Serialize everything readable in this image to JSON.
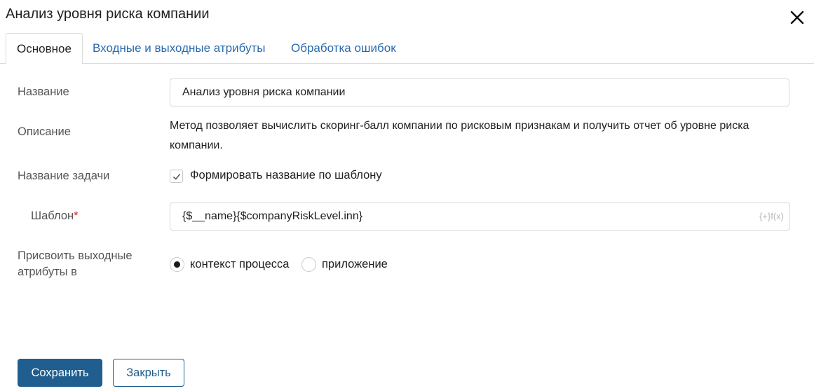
{
  "dialog": {
    "title": "Анализ уровня риска компании",
    "close_icon": "close-icon"
  },
  "tabs": [
    {
      "label": "Основное",
      "active": true
    },
    {
      "label": "Входные и выходные атрибуты",
      "active": false
    },
    {
      "label": "Обработка ошибок",
      "active": false
    }
  ],
  "form": {
    "name": {
      "label": "Название",
      "value": "Анализ уровня риска компании"
    },
    "description": {
      "label": "Описание",
      "value": "Метод позволяет вычислить скоринг-балл компании по рисковым признакам и получить отчет об уровне риска компании."
    },
    "task_name": {
      "label": "Название задачи",
      "checkbox_label": "Формировать название по шаблону",
      "checked": true
    },
    "template": {
      "label": "Шаблон",
      "required_mark": "*",
      "value": "{$__name}{$companyRiskLevel.inn}",
      "fx_icon_text": "{+}f(x)"
    },
    "assign_outputs": {
      "label_line1": "Присвоить выходные",
      "label_line2": "атрибуты в",
      "options": [
        {
          "label": "контекст процесса",
          "selected": true
        },
        {
          "label": "приложение",
          "selected": false
        }
      ]
    }
  },
  "footer": {
    "save_label": "Сохранить",
    "close_label": "Закрыть"
  },
  "colors": {
    "primary": "#1f5e8e",
    "link": "#2a6bb0",
    "required": "#d9262b",
    "label": "#555555"
  }
}
